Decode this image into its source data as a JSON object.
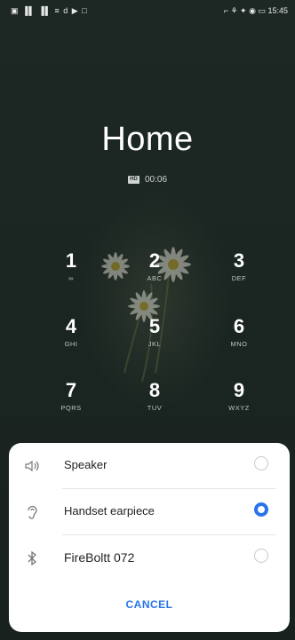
{
  "status_bar": {
    "left_icons": "▣ ▐▌ ▐▌ ≡ d ▶ □",
    "right_icons": "⌐ ⚘ ✦ ◉ ▭",
    "time": "15:45"
  },
  "call": {
    "caller_name": "Home",
    "hd_badge": "HD",
    "duration": "00:06"
  },
  "keypad": [
    {
      "digit": "1",
      "letters": "∞"
    },
    {
      "digit": "2",
      "letters": "ABC"
    },
    {
      "digit": "3",
      "letters": "DEF"
    },
    {
      "digit": "4",
      "letters": "GHI"
    },
    {
      "digit": "5",
      "letters": "JKL"
    },
    {
      "digit": "6",
      "letters": "MNO"
    },
    {
      "digit": "7",
      "letters": "PQRS"
    },
    {
      "digit": "8",
      "letters": "TUV"
    },
    {
      "digit": "9",
      "letters": "WXYZ"
    }
  ],
  "audio_sheet": {
    "options": [
      {
        "label": "Speaker",
        "icon": "speaker-icon",
        "selected": false
      },
      {
        "label": "Handset earpiece",
        "icon": "ear-icon",
        "selected": true
      },
      {
        "label": "FireBoltt 072",
        "icon": "bluetooth-icon",
        "selected": false
      }
    ],
    "cancel_label": "CANCEL"
  },
  "colors": {
    "background": "#1f2a26",
    "accent": "#2a74ea"
  }
}
